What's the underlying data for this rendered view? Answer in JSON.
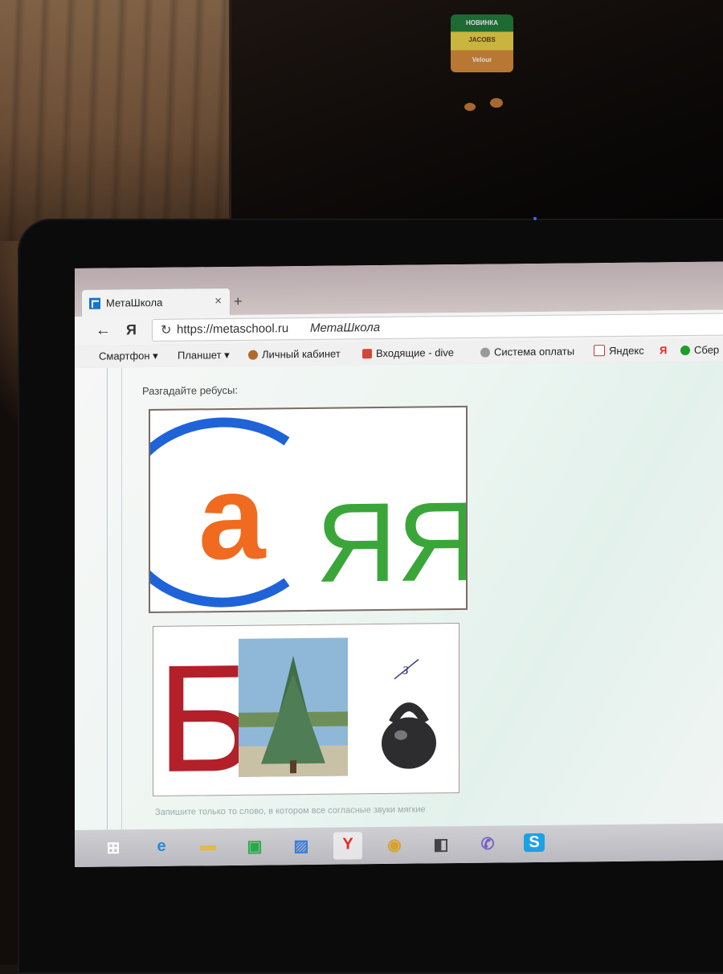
{
  "background": {
    "jar_label_lines": [
      "НОВИНКА",
      "JACOBS",
      "Velour"
    ]
  },
  "browser": {
    "tab": {
      "title": "МетаШкола",
      "close_glyph": "×"
    },
    "new_tab_glyph": "+",
    "nav": {
      "back_glyph": "←",
      "yandex_glyph": "Я",
      "reload_glyph": "↻"
    },
    "address": {
      "url": "https://metaschool.ru",
      "page_title": "МетаШкола"
    },
    "bookmarks": [
      {
        "label": "Смартфон ▾",
        "icon": "none",
        "color": ""
      },
      {
        "label": "Планшет ▾",
        "icon": "none",
        "color": ""
      },
      {
        "label": "Личный кабинет",
        "icon": "pin-icon",
        "color": "#b06a2a"
      },
      {
        "label": "Входящие - dive",
        "icon": "gmail-icon",
        "color": "#d44638"
      },
      {
        "label": "Система оплаты",
        "icon": "bulb-icon",
        "color": "#888888"
      },
      {
        "label": "Яндекс",
        "icon": "yandex-icon",
        "color": "#e52620"
      },
      {
        "label": "",
        "icon": "yandex-letter-icon",
        "color": "#e52620"
      },
      {
        "label": "Сбер",
        "icon": "sber-icon",
        "color": "#1a9f29"
      }
    ]
  },
  "page": {
    "instruction": "Разгадайте ребусы:",
    "puzzle1": {
      "outer_letter": "С",
      "inner_letter": "а",
      "tail_letters": "ЯЯЯ",
      "colors": {
        "outer": "#1f63d8",
        "inner": "#f06a1f",
        "tail": "#3aa63a"
      }
    },
    "puzzle2": {
      "letter": "Б",
      "letter_color": "#b3202a",
      "image1": "spruce-tree",
      "image2": "kettlebell",
      "crossed_mark": "з"
    },
    "footer_note": "Запишите только то слово, в котором все согласные звуки мягкие"
  },
  "taskbar": {
    "items": [
      {
        "name": "start-icon",
        "glyph": "⊞",
        "color": "#ffffff"
      },
      {
        "name": "ie-icon",
        "glyph": "e",
        "color": "#2a8ad4"
      },
      {
        "name": "explorer-icon",
        "glyph": "▬",
        "color": "#e3b94a"
      },
      {
        "name": "store-icon",
        "glyph": "▣",
        "color": "#2aa84a"
      },
      {
        "name": "photos-icon",
        "glyph": "▨",
        "color": "#3a7bd5"
      },
      {
        "name": "yandex-browser-icon",
        "glyph": "Y",
        "color": "#e52620"
      },
      {
        "name": "chrome-icon",
        "glyph": "◉",
        "color": "#d9a12a"
      },
      {
        "name": "app-icon",
        "glyph": "◧",
        "color": "#444444"
      },
      {
        "name": "viber-icon",
        "glyph": "✆",
        "color": "#7a5ac8"
      },
      {
        "name": "skype-icon",
        "glyph": "S",
        "color": "#1da1e6"
      }
    ]
  }
}
